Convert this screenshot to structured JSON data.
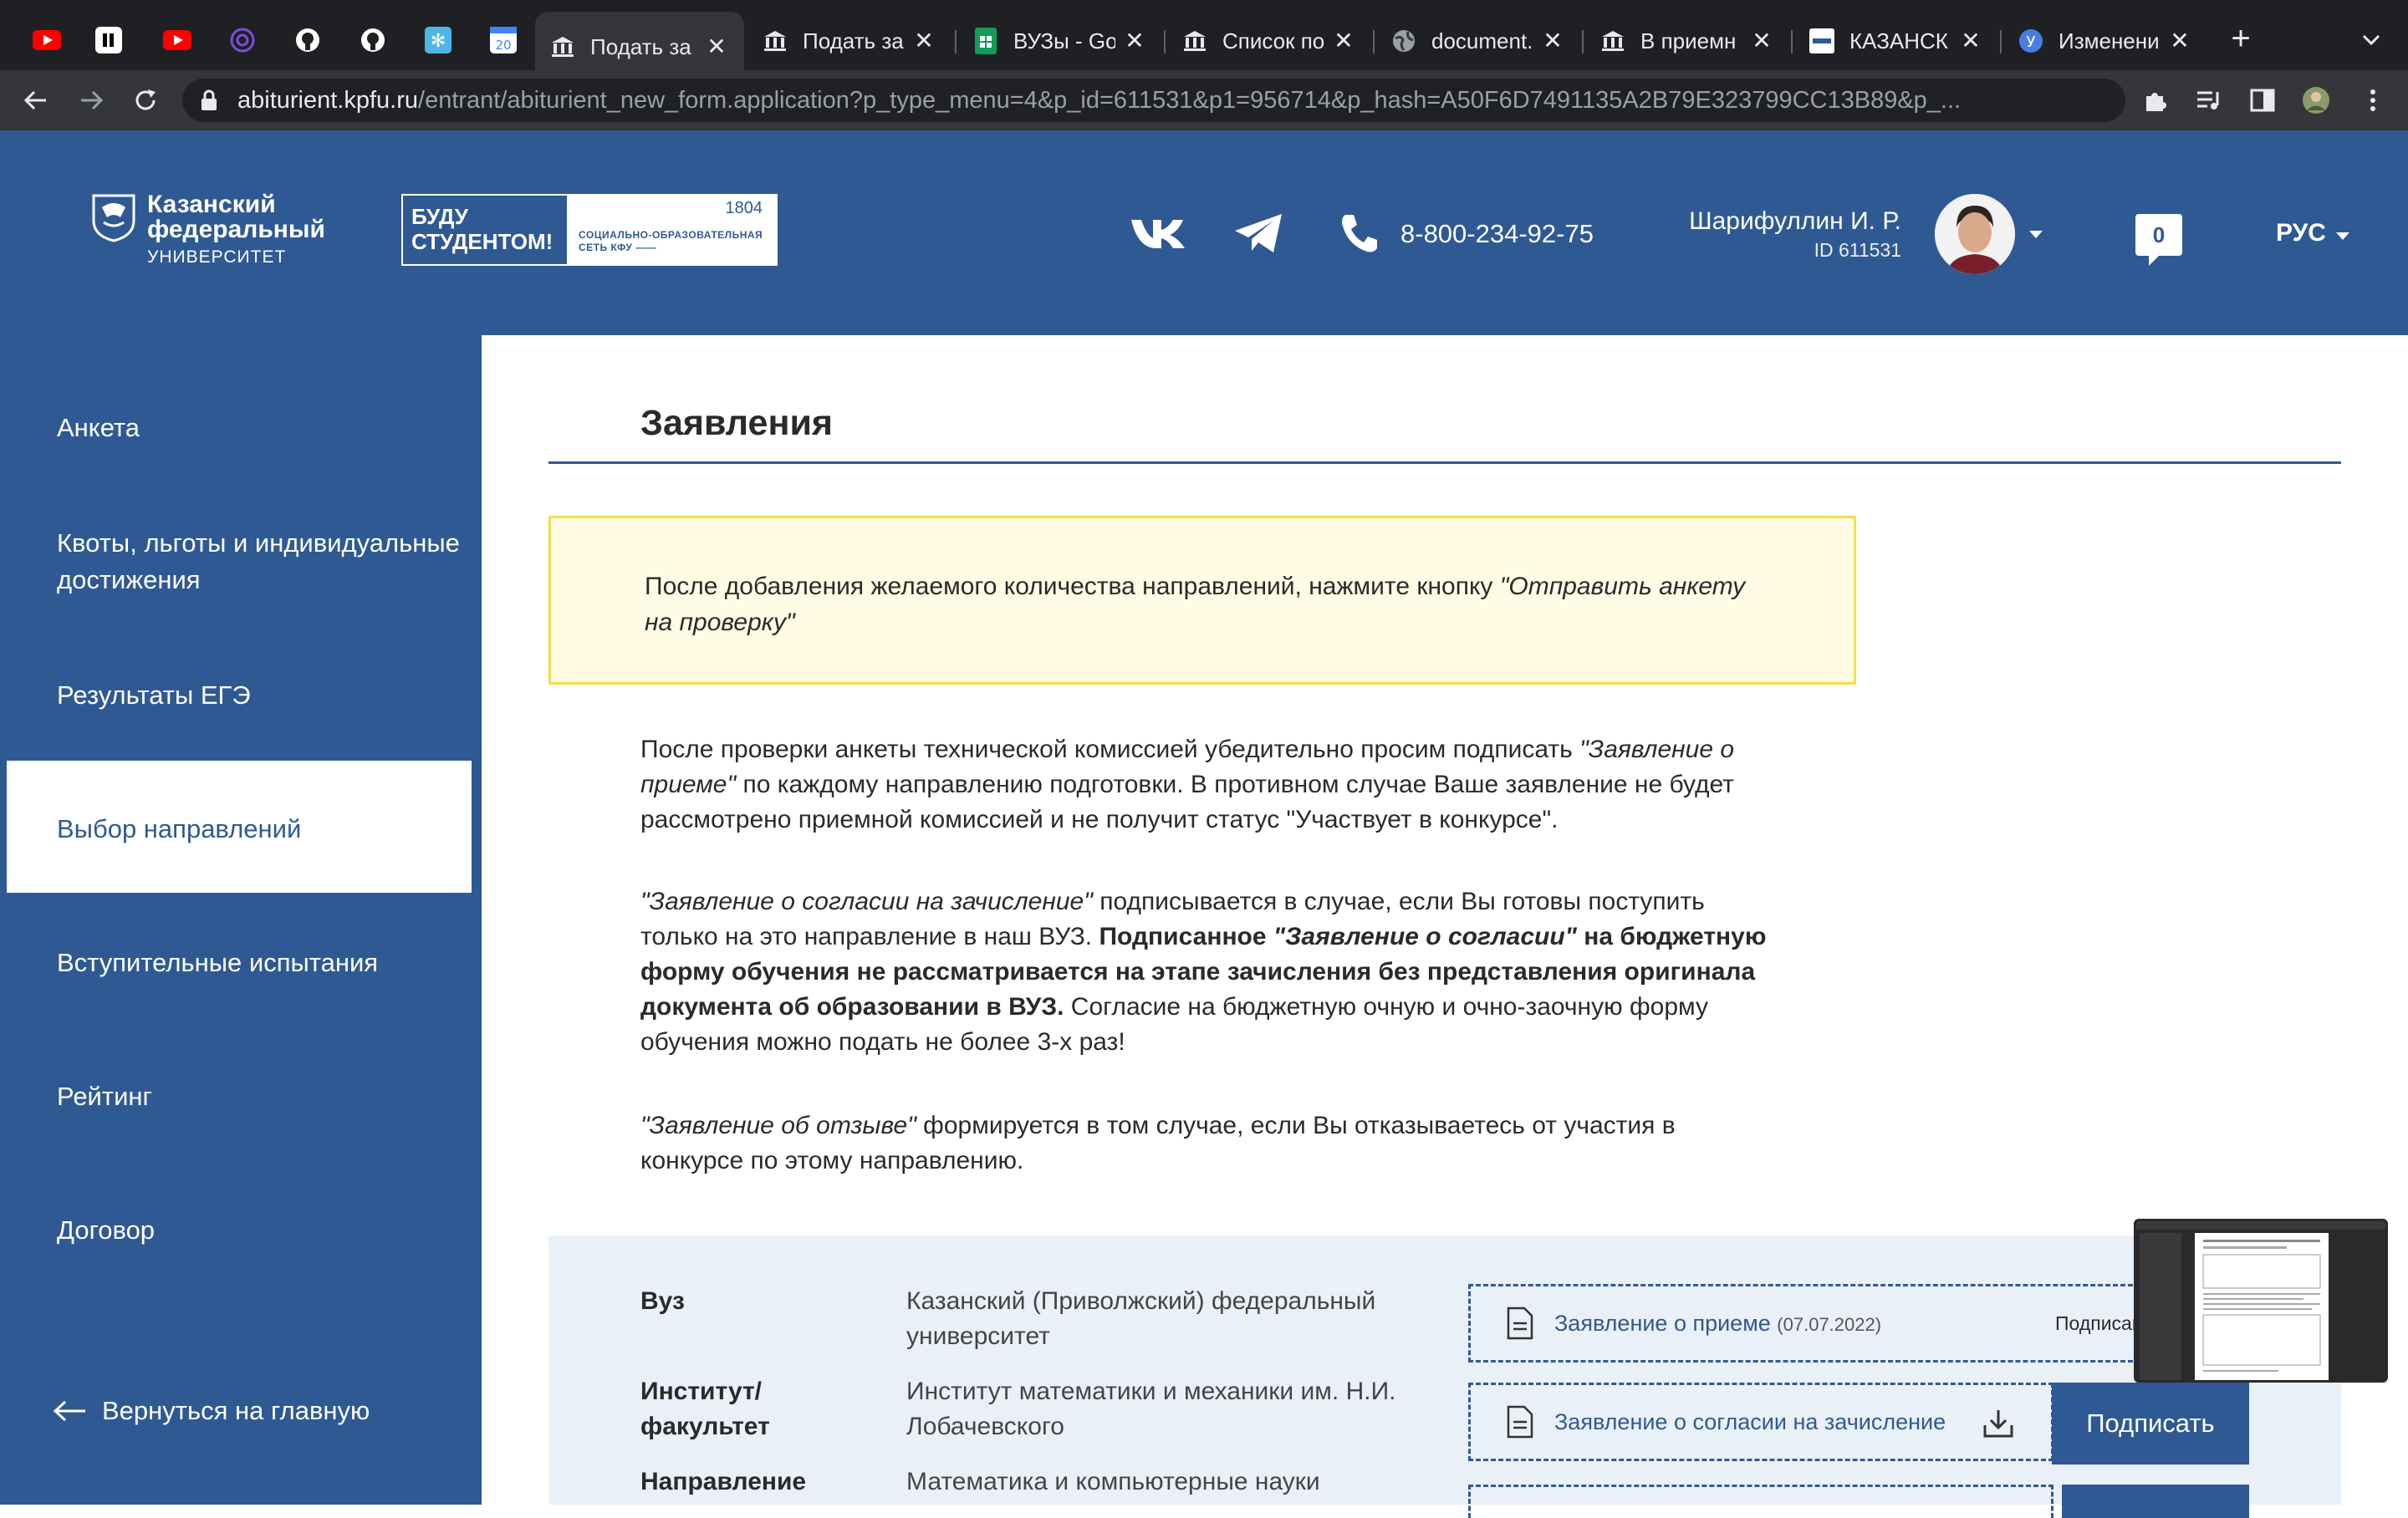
{
  "browser": {
    "tabs": [
      {
        "title": "Подать за",
        "active": true
      },
      {
        "title": "Подать за",
        "active": false
      },
      {
        "title": "ВУЗы - Go",
        "active": false
      },
      {
        "title": "Список по",
        "active": false
      },
      {
        "title": "document.",
        "active": false
      },
      {
        "title": "В приемн",
        "active": false
      },
      {
        "title": "КАЗАНСК",
        "active": false
      },
      {
        "title": "Изменени",
        "active": false
      }
    ],
    "pinned_tab_badge": "20",
    "url_domain": "abiturient.kpfu.ru",
    "url_path": "/entrant/abiturient_new_form.application?p_type_menu=4&p_id=611531&p1=956714&p_hash=A50F6D7491135A2B79E323799CC13B89&p_..."
  },
  "header": {
    "logo_line1": "Казанский",
    "logo_line2": "федеральный",
    "logo_line3": "УНИВЕРСИТЕТ",
    "banner_left_line1": "БУДУ",
    "banner_left_line2": "СТУДЕНТОМ!",
    "banner_year": "1804",
    "banner_soc_line1": "СОЦИАЛЬНО-ОБРАЗОВАТЕЛЬНАЯ",
    "banner_soc_line2": "СЕТЬ КФУ ——",
    "phone": "8-800-234-92-75",
    "user_name": "Шарифуллин И. Р.",
    "user_id": "ID 611531",
    "notifications": "0",
    "language": "РУС"
  },
  "sidebar": {
    "items": [
      {
        "label": "Анкета"
      },
      {
        "label": "Квоты, льготы и индивидуальные достижения"
      },
      {
        "label": "Результаты ЕГЭ"
      },
      {
        "label": "Выбор направлений"
      },
      {
        "label": "Вступительные испытания"
      },
      {
        "label": "Рейтинг"
      },
      {
        "label": "Договор"
      }
    ],
    "back_label": "Вернуться на главную"
  },
  "main": {
    "title": "Заявления",
    "notice_plain": "После добавления желаемого количества направлений, нажмите кнопку ",
    "notice_em": "\"Отправить анкету на проверку\"",
    "para1_a": "После проверки анкеты технической комиссией убедительно просим подписать ",
    "para1_em": "\"Заявление о приеме\"",
    "para1_b": " по каждому направлению подготовки. В противном случае Ваше заявление не будет рассмотрено приемной комиссией и не получит статус \"Участвует в конкурсе\".",
    "para2_em": "\"Заявление о согласии на зачисление\"",
    "para2_a": " подписывается в случае, если Вы готовы поступить только на это направление в наш ВУЗ. ",
    "para2_bold1": "Подписанное ",
    "para2_bold_em": "\"Заявление о согласии\"",
    "para2_bold2": " на бюджетную форму обучения не рассматривается на этапе зачисления без представления оригинала документа об образовании в ВУЗ.",
    "para2_b": " Согласие на бюджетную очную и очно-заочную форму обучения можно подать не более 3-х раз!",
    "para3_em": "\"Заявление об отзыве\"",
    "para3_a": " формируется в том случае, если Вы отказываетесь от участия в конкурсе по этому направлению."
  },
  "application": {
    "rows": [
      {
        "label": "Вуз",
        "value": "Казанский (Приволжский) федеральный университет"
      },
      {
        "label": "Институт/ факультет",
        "value": "Институт математики и механики им. Н.И. Лобачевского"
      },
      {
        "label": "Направление",
        "value": "Математика и компьютерные науки"
      }
    ],
    "doc1_label": "Заявление о приеме",
    "doc1_date": "(07.07.2022)",
    "doc1_status": "Подписано",
    "doc2_label": "Заявление о согласии на зачисление",
    "sign_button": "Подписать"
  }
}
